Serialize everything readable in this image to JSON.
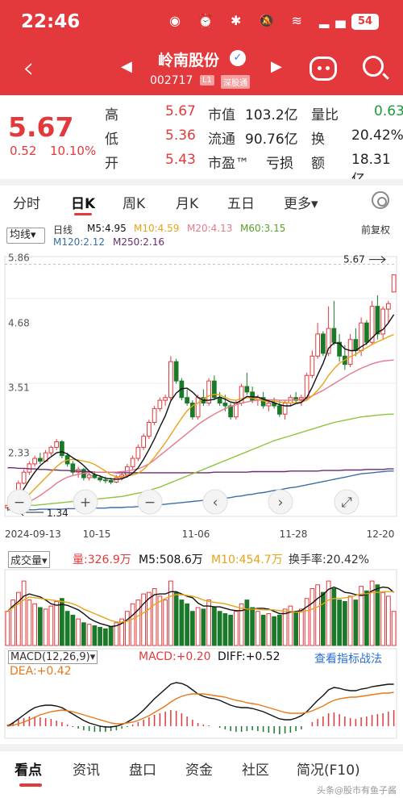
{
  "status": {
    "time": "22:46",
    "battery": "54"
  },
  "header": {
    "stock_name": "岭南股份",
    "code": "002717",
    "tag_level": "L1",
    "tag_exchange": "深股通"
  },
  "quote": {
    "price": "5.67",
    "change": "0.52",
    "change_pct": "10.10%",
    "high_label": "高",
    "high": "5.67",
    "low_label": "低",
    "low": "5.36",
    "open_label": "开",
    "open": "5.43",
    "mktcap_label": "市值",
    "mktcap": "103.2亿",
    "float_label": "流通",
    "float": "90.76亿",
    "pe_label": "市盈™",
    "pe": "亏损",
    "volratio_label": "量比",
    "volratio": "0.63",
    "turnover_label": "换",
    "turnover": "20.42%",
    "amount_label": "额",
    "amount": "18.31亿"
  },
  "tabs": [
    "分时",
    "日K",
    "周K",
    "月K",
    "五日",
    "更多▾"
  ],
  "ma_legend": {
    "selector": "均线▾",
    "rights": "前复权",
    "daily": "日线",
    "m5": "M5:4.95",
    "m10": "M10:4.59",
    "m20": "M20:4.13",
    "m60": "M60:3.15",
    "m120": "M120:2.12",
    "m250": "M250:2.16"
  },
  "colors": {
    "up": "#e4393c",
    "down": "#1a7a2a",
    "m5": "#111111",
    "m10": "#e8a317",
    "m20": "#e47a8a",
    "m60": "#8cc63f",
    "m120": "#3a6ea5",
    "m250": "#6a2c70"
  },
  "chart_data": {
    "type": "candlestick",
    "y_ticks": [
      "5.86",
      "4.68",
      "3.51",
      "2.33"
    ],
    "x_ticks": [
      "2024-09-13",
      "10-15",
      "11-06",
      "11-28",
      "12-20"
    ],
    "max_label": "5.67",
    "min_label": "1.34",
    "controls": [
      "−",
      "+",
      "−",
      "‹",
      "›",
      "⤢"
    ],
    "candles": [
      [
        1.45,
        1.55,
        1.4,
        1.5
      ],
      [
        1.5,
        1.75,
        1.48,
        1.72
      ],
      [
        1.72,
        1.95,
        1.7,
        1.9
      ],
      [
        1.9,
        2.15,
        1.88,
        2.1
      ],
      [
        2.1,
        2.3,
        2.05,
        2.25
      ],
      [
        2.25,
        2.4,
        2.2,
        2.35
      ],
      [
        2.35,
        2.45,
        2.25,
        2.3
      ],
      [
        2.3,
        2.5,
        2.28,
        2.45
      ],
      [
        2.45,
        2.58,
        2.4,
        2.55
      ],
      [
        2.55,
        2.7,
        2.5,
        2.65
      ],
      [
        2.65,
        2.68,
        2.35,
        2.4
      ],
      [
        2.4,
        2.45,
        2.2,
        2.25
      ],
      [
        2.25,
        2.3,
        2.05,
        2.1
      ],
      [
        2.1,
        2.2,
        2.0,
        2.15
      ],
      [
        2.15,
        2.18,
        1.95,
        2.0
      ],
      [
        2.0,
        2.1,
        1.95,
        2.05
      ],
      [
        2.05,
        2.12,
        1.98,
        2.0
      ],
      [
        2.0,
        2.05,
        1.92,
        1.96
      ],
      [
        1.96,
        2.02,
        1.9,
        1.95
      ],
      [
        1.95,
        2.0,
        1.88,
        1.92
      ],
      [
        1.92,
        2.05,
        1.9,
        2.0
      ],
      [
        2.0,
        2.1,
        1.95,
        2.05
      ],
      [
        2.05,
        2.25,
        2.0,
        2.2
      ],
      [
        2.2,
        2.4,
        2.15,
        2.35
      ],
      [
        2.35,
        2.6,
        2.3,
        2.55
      ],
      [
        2.55,
        2.8,
        2.5,
        2.75
      ],
      [
        2.75,
        3.05,
        2.7,
        3.0
      ],
      [
        3.0,
        3.3,
        2.95,
        3.25
      ],
      [
        3.25,
        3.45,
        3.2,
        3.4
      ],
      [
        3.4,
        3.5,
        3.3,
        3.45
      ],
      [
        3.45,
        4.2,
        3.4,
        4.1
      ],
      [
        4.1,
        4.15,
        3.7,
        3.75
      ],
      [
        3.75,
        3.8,
        3.4,
        3.45
      ],
      [
        3.45,
        3.6,
        3.3,
        3.35
      ],
      [
        3.35,
        3.4,
        3.05,
        3.1
      ],
      [
        3.1,
        3.5,
        3.05,
        3.45
      ],
      [
        3.45,
        3.6,
        3.3,
        3.35
      ],
      [
        3.35,
        3.8,
        3.3,
        3.75
      ],
      [
        3.75,
        3.85,
        3.4,
        3.45
      ],
      [
        3.45,
        3.55,
        3.3,
        3.35
      ],
      [
        3.35,
        3.5,
        3.2,
        3.3
      ],
      [
        3.3,
        3.35,
        3.05,
        3.1
      ],
      [
        3.1,
        3.4,
        3.05,
        3.35
      ],
      [
        3.35,
        3.7,
        3.3,
        3.65
      ],
      [
        3.65,
        3.9,
        3.5,
        3.55
      ],
      [
        3.55,
        3.65,
        3.35,
        3.4
      ],
      [
        3.4,
        3.5,
        3.3,
        3.45
      ],
      [
        3.45,
        3.55,
        3.25,
        3.3
      ],
      [
        3.3,
        3.4,
        3.2,
        3.35
      ],
      [
        3.35,
        3.45,
        3.25,
        3.3
      ],
      [
        3.3,
        3.4,
        3.1,
        3.15
      ],
      [
        3.15,
        3.4,
        3.05,
        3.35
      ],
      [
        3.35,
        3.5,
        3.3,
        3.45
      ],
      [
        3.45,
        3.55,
        3.35,
        3.4
      ],
      [
        3.4,
        3.5,
        3.3,
        3.45
      ],
      [
        3.45,
        3.9,
        3.4,
        3.85
      ],
      [
        3.85,
        4.3,
        3.8,
        4.2
      ],
      [
        4.2,
        4.8,
        4.15,
        4.6
      ],
      [
        4.6,
        4.65,
        4.2,
        4.25
      ],
      [
        4.25,
        5.1,
        4.2,
        4.7
      ],
      [
        4.7,
        5.2,
        4.4,
        4.45
      ],
      [
        4.45,
        4.6,
        4.1,
        4.2
      ],
      [
        4.2,
        4.4,
        3.95,
        4.05
      ],
      [
        4.05,
        4.6,
        4.0,
        4.5
      ],
      [
        4.5,
        4.7,
        4.2,
        4.3
      ],
      [
        4.3,
        4.9,
        4.2,
        4.8
      ],
      [
        4.8,
        4.85,
        4.4,
        4.45
      ],
      [
        4.45,
        5.2,
        4.4,
        5.1
      ],
      [
        5.1,
        5.3,
        4.5,
        4.6
      ],
      [
        4.6,
        5.1,
        4.5,
        5.05
      ],
      [
        5.05,
        5.2,
        4.8,
        5.15
      ],
      [
        5.36,
        5.67,
        5.36,
        5.67
      ]
    ],
    "m5": [
      1.45,
      1.55,
      1.65,
      1.8,
      1.96,
      2.1,
      2.22,
      2.3,
      2.38,
      2.45,
      2.47,
      2.43,
      2.36,
      2.3,
      2.22,
      2.12,
      2.06,
      2.03,
      1.99,
      1.98,
      1.97,
      1.98,
      2.02,
      2.08,
      2.18,
      2.33,
      2.51,
      2.7,
      2.92,
      3.12,
      3.39,
      3.53,
      3.61,
      3.62,
      3.55,
      3.45,
      3.4,
      3.4,
      3.42,
      3.46,
      3.42,
      3.37,
      3.35,
      3.4,
      3.47,
      3.46,
      3.46,
      3.42,
      3.39,
      3.36,
      3.32,
      3.3,
      3.3,
      3.34,
      3.36,
      3.45,
      3.64,
      3.86,
      4.07,
      4.34,
      4.44,
      4.43,
      4.33,
      4.3,
      4.3,
      4.37,
      4.43,
      4.53,
      4.63,
      4.68,
      4.8,
      4.95
    ],
    "m10": [
      1.45,
      1.5,
      1.55,
      1.62,
      1.7,
      1.8,
      1.9,
      2.0,
      2.1,
      2.2,
      2.28,
      2.32,
      2.33,
      2.32,
      2.3,
      2.28,
      2.24,
      2.18,
      2.12,
      2.05,
      2.02,
      2.02,
      2.03,
      2.05,
      2.08,
      2.15,
      2.25,
      2.37,
      2.5,
      2.63,
      2.78,
      2.93,
      3.08,
      3.21,
      3.3,
      3.35,
      3.43,
      3.48,
      3.51,
      3.5,
      3.45,
      3.41,
      3.4,
      3.43,
      3.45,
      3.44,
      3.42,
      3.39,
      3.38,
      3.39,
      3.37,
      3.36,
      3.35,
      3.36,
      3.37,
      3.4,
      3.48,
      3.58,
      3.7,
      3.85,
      3.97,
      4.07,
      4.13,
      4.19,
      4.23,
      4.3,
      4.35,
      4.41,
      4.46,
      4.5,
      4.55,
      4.59
    ],
    "m20": [
      1.45,
      1.47,
      1.5,
      1.53,
      1.57,
      1.62,
      1.68,
      1.75,
      1.82,
      1.9,
      1.96,
      2.01,
      2.04,
      2.06,
      2.08,
      2.09,
      2.1,
      2.1,
      2.1,
      2.1,
      2.1,
      2.11,
      2.12,
      2.14,
      2.16,
      2.2,
      2.25,
      2.32,
      2.4,
      2.48,
      2.56,
      2.64,
      2.72,
      2.8,
      2.88,
      2.96,
      3.03,
      3.09,
      3.15,
      3.2,
      3.25,
      3.29,
      3.32,
      3.35,
      3.37,
      3.39,
      3.4,
      3.41,
      3.41,
      3.41,
      3.4,
      3.4,
      3.4,
      3.41,
      3.42,
      3.44,
      3.48,
      3.53,
      3.58,
      3.64,
      3.7,
      3.76,
      3.82,
      3.88,
      3.93,
      3.98,
      4.02,
      4.06,
      4.09,
      4.11,
      4.12,
      4.13
    ],
    "m60": [
      1.48,
      1.48,
      1.49,
      1.49,
      1.5,
      1.5,
      1.51,
      1.52,
      1.53,
      1.54,
      1.55,
      1.56,
      1.57,
      1.58,
      1.59,
      1.6,
      1.61,
      1.62,
      1.63,
      1.64,
      1.65,
      1.66,
      1.68,
      1.7,
      1.72,
      1.74,
      1.77,
      1.8,
      1.83,
      1.87,
      1.91,
      1.95,
      1.99,
      2.03,
      2.07,
      2.11,
      2.15,
      2.19,
      2.23,
      2.27,
      2.31,
      2.35,
      2.39,
      2.43,
      2.47,
      2.51,
      2.55,
      2.59,
      2.63,
      2.67,
      2.7,
      2.73,
      2.76,
      2.79,
      2.82,
      2.85,
      2.88,
      2.91,
      2.94,
      2.97,
      3.0,
      3.02,
      3.04,
      3.06,
      3.08,
      3.1,
      3.11,
      3.12,
      3.13,
      3.14,
      3.15,
      3.15
    ],
    "m120": [
      1.42,
      1.42,
      1.42,
      1.42,
      1.42,
      1.42,
      1.43,
      1.43,
      1.43,
      1.43,
      1.43,
      1.44,
      1.44,
      1.44,
      1.44,
      1.44,
      1.45,
      1.45,
      1.45,
      1.46,
      1.46,
      1.46,
      1.47,
      1.47,
      1.48,
      1.48,
      1.49,
      1.5,
      1.51,
      1.52,
      1.53,
      1.54,
      1.55,
      1.56,
      1.57,
      1.58,
      1.59,
      1.6,
      1.61,
      1.62,
      1.63,
      1.64,
      1.66,
      1.67,
      1.69,
      1.7,
      1.72,
      1.73,
      1.75,
      1.77,
      1.78,
      1.8,
      1.82,
      1.83,
      1.85,
      1.87,
      1.89,
      1.91,
      1.93,
      1.95,
      1.97,
      1.99,
      2.01,
      2.03,
      2.05,
      2.07,
      2.08,
      2.09,
      2.1,
      2.11,
      2.12,
      2.12
    ],
    "m250": [
      2.18,
      2.18,
      2.17,
      2.17,
      2.16,
      2.16,
      2.15,
      2.15,
      2.14,
      2.14,
      2.13,
      2.13,
      2.12,
      2.12,
      2.11,
      2.11,
      2.1,
      2.1,
      2.1,
      2.1,
      2.09,
      2.09,
      2.09,
      2.09,
      2.09,
      2.09,
      2.09,
      2.09,
      2.09,
      2.09,
      2.09,
      2.09,
      2.09,
      2.09,
      2.09,
      2.09,
      2.09,
      2.09,
      2.1,
      2.1,
      2.1,
      2.1,
      2.1,
      2.1,
      2.1,
      2.11,
      2.11,
      2.11,
      2.11,
      2.11,
      2.11,
      2.11,
      2.12,
      2.12,
      2.12,
      2.12,
      2.12,
      2.12,
      2.13,
      2.13,
      2.13,
      2.13,
      2.14,
      2.14,
      2.14,
      2.14,
      2.15,
      2.15,
      2.15,
      2.15,
      2.16,
      2.16
    ],
    "y_range": [
      1.3,
      6.0
    ]
  },
  "volume": {
    "selector": "成交量▾",
    "vol": "量:326.9万",
    "m5": "M5:508.6万",
    "m10": "M10:454.7万",
    "turnover": "换手率:20.42%",
    "values": [
      45,
      60,
      70,
      85,
      60,
      55,
      50,
      48,
      52,
      58,
      62,
      45,
      40,
      35,
      30,
      28,
      26,
      24,
      22,
      25,
      30,
      35,
      45,
      55,
      60,
      68,
      70,
      75,
      65,
      60,
      85,
      70,
      60,
      55,
      45,
      50,
      48,
      60,
      50,
      45,
      42,
      40,
      45,
      55,
      60,
      50,
      45,
      40,
      42,
      38,
      40,
      48,
      52,
      45,
      48,
      62,
      75,
      80,
      70,
      85,
      75,
      60,
      58,
      65,
      60,
      78,
      72,
      85,
      80,
      70,
      65,
      45
    ],
    "ma5": [
      45,
      52,
      58,
      65,
      68,
      66,
      64,
      60,
      55,
      53,
      54,
      53,
      50,
      47,
      42,
      36,
      32,
      29,
      27,
      25,
      26,
      29,
      34,
      40,
      47,
      55,
      62,
      67,
      68,
      68,
      71,
      71,
      68,
      65,
      63,
      56,
      52,
      52,
      51,
      51,
      49,
      47,
      46,
      46,
      48,
      48,
      49,
      49,
      48,
      45,
      42,
      42,
      44,
      45,
      46,
      51,
      56,
      62,
      67,
      74,
      77,
      74,
      70,
      69,
      67,
      66,
      67,
      72,
      75,
      77,
      76,
      70
    ],
    "ma10": [
      45,
      50,
      55,
      60,
      64,
      63,
      62,
      61,
      60,
      59,
      58,
      57,
      55,
      52,
      48,
      45,
      42,
      39,
      36,
      33,
      31,
      31,
      32,
      35,
      39,
      43,
      48,
      54,
      58,
      62,
      65,
      67,
      67,
      66,
      65,
      63,
      60,
      58,
      57,
      56,
      55,
      53,
      51,
      49,
      48,
      48,
      48,
      47,
      47,
      47,
      46,
      45,
      45,
      44,
      44,
      46,
      48,
      51,
      55,
      60,
      62,
      62,
      63,
      64,
      66,
      68,
      68,
      70,
      70,
      71,
      71,
      71
    ],
    "ylim": [
      0,
      100
    ]
  },
  "macd": {
    "selector": "MACD(12,26,9)▾",
    "macd": "MACD:+0.20",
    "diff": "DIFF:+0.52",
    "dea": "DEA:+0.42",
    "link": "查看指标战法",
    "hist": [
      0.02,
      0.05,
      0.08,
      0.1,
      0.12,
      0.12,
      0.11,
      0.1,
      0.09,
      0.07,
      0.05,
      0.02,
      -0.01,
      -0.03,
      -0.05,
      -0.06,
      -0.07,
      -0.07,
      -0.07,
      -0.06,
      -0.05,
      -0.03,
      -0.01,
      0.02,
      0.05,
      0.08,
      0.11,
      0.14,
      0.16,
      0.18,
      0.2,
      0.19,
      0.16,
      0.12,
      0.08,
      0.04,
      0.02,
      0.01,
      0.0,
      -0.02,
      -0.04,
      -0.06,
      -0.07,
      -0.07,
      -0.06,
      -0.05,
      -0.06,
      -0.07,
      -0.08,
      -0.09,
      -0.1,
      -0.09,
      -0.08,
      -0.06,
      -0.04,
      0.0,
      0.05,
      0.09,
      0.12,
      0.16,
      0.17,
      0.15,
      0.12,
      0.1,
      0.09,
      0.11,
      0.12,
      0.14,
      0.15,
      0.16,
      0.18,
      0.2
    ],
    "diff_series": [
      0.0,
      0.04,
      0.09,
      0.14,
      0.19,
      0.23,
      0.25,
      0.26,
      0.26,
      0.25,
      0.23,
      0.19,
      0.15,
      0.11,
      0.07,
      0.04,
      0.02,
      0.0,
      -0.01,
      -0.01,
      0.0,
      0.02,
      0.05,
      0.09,
      0.14,
      0.2,
      0.27,
      0.34,
      0.4,
      0.46,
      0.52,
      0.54,
      0.53,
      0.5,
      0.45,
      0.4,
      0.37,
      0.35,
      0.34,
      0.32,
      0.29,
      0.26,
      0.24,
      0.23,
      0.23,
      0.22,
      0.2,
      0.18,
      0.15,
      0.12,
      0.09,
      0.08,
      0.08,
      0.1,
      0.13,
      0.18,
      0.25,
      0.32,
      0.38,
      0.45,
      0.48,
      0.47,
      0.45,
      0.44,
      0.44,
      0.46,
      0.47,
      0.49,
      0.5,
      0.51,
      0.52,
      0.52
    ],
    "dea_series": [
      0.0,
      0.01,
      0.03,
      0.05,
      0.08,
      0.11,
      0.14,
      0.16,
      0.18,
      0.19,
      0.2,
      0.19,
      0.18,
      0.16,
      0.14,
      0.12,
      0.1,
      0.08,
      0.06,
      0.04,
      0.03,
      0.03,
      0.04,
      0.05,
      0.07,
      0.1,
      0.13,
      0.17,
      0.21,
      0.25,
      0.3,
      0.34,
      0.37,
      0.39,
      0.4,
      0.4,
      0.4,
      0.39,
      0.38,
      0.37,
      0.36,
      0.34,
      0.32,
      0.31,
      0.29,
      0.28,
      0.27,
      0.25,
      0.23,
      0.21,
      0.19,
      0.17,
      0.16,
      0.16,
      0.16,
      0.17,
      0.19,
      0.22,
      0.25,
      0.29,
      0.32,
      0.34,
      0.35,
      0.36,
      0.36,
      0.37,
      0.38,
      0.39,
      0.4,
      0.41,
      0.41,
      0.42
    ],
    "ylim": [
      -0.15,
      0.6
    ]
  },
  "bottom_tabs": [
    "看点",
    "资讯",
    "盘口",
    "资金",
    "社区",
    "简况(F10)"
  ],
  "watermark": "头条@股市有鱼子酱"
}
